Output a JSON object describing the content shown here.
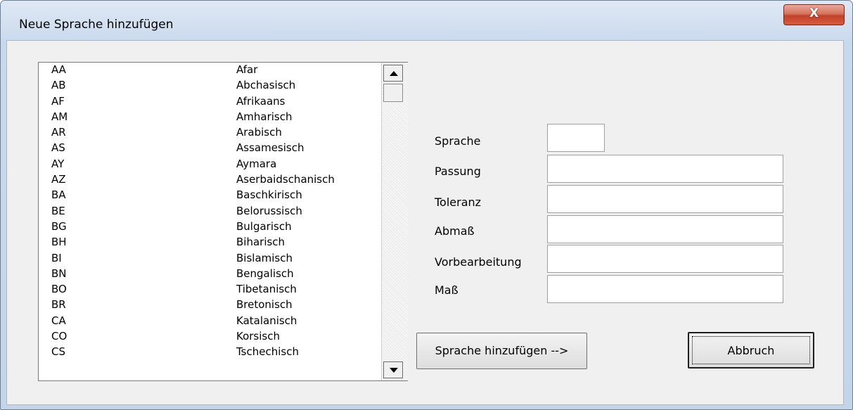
{
  "window": {
    "title": "Neue Sprache hinzufügen",
    "close_label": "X"
  },
  "languages": [
    {
      "code": "AA",
      "name": "Afar"
    },
    {
      "code": "AB",
      "name": "Abchasisch"
    },
    {
      "code": "AF",
      "name": "Afrikaans"
    },
    {
      "code": "AM",
      "name": "Amharisch"
    },
    {
      "code": "AR",
      "name": "Arabisch"
    },
    {
      "code": "AS",
      "name": "Assamesisch"
    },
    {
      "code": "AY",
      "name": "Aymara"
    },
    {
      "code": "AZ",
      "name": "Aserbaidschanisch"
    },
    {
      "code": "BA",
      "name": "Baschkirisch"
    },
    {
      "code": "BE",
      "name": "Belorussisch"
    },
    {
      "code": "BG",
      "name": "Bulgarisch"
    },
    {
      "code": "BH",
      "name": "Biharisch"
    },
    {
      "code": "BI",
      "name": "Bislamisch"
    },
    {
      "code": "BN",
      "name": "Bengalisch"
    },
    {
      "code": "BO",
      "name": "Tibetanisch"
    },
    {
      "code": "BR",
      "name": "Bretonisch"
    },
    {
      "code": "CA",
      "name": "Katalanisch"
    },
    {
      "code": "CO",
      "name": "Korsisch"
    },
    {
      "code": "CS",
      "name": "Tschechisch"
    }
  ],
  "form": {
    "sprache": {
      "label": "Sprache",
      "value": ""
    },
    "passung": {
      "label": "Passung",
      "value": ""
    },
    "toleranz": {
      "label": "Toleranz",
      "value": ""
    },
    "abmass": {
      "label": "Abmaß",
      "value": ""
    },
    "vorbearbeitung": {
      "label": "Vorbearbeitung",
      "value": ""
    },
    "mass": {
      "label": "Maß",
      "value": ""
    }
  },
  "buttons": {
    "add": "Sprache hinzufügen -->",
    "cancel": "Abbruch"
  }
}
